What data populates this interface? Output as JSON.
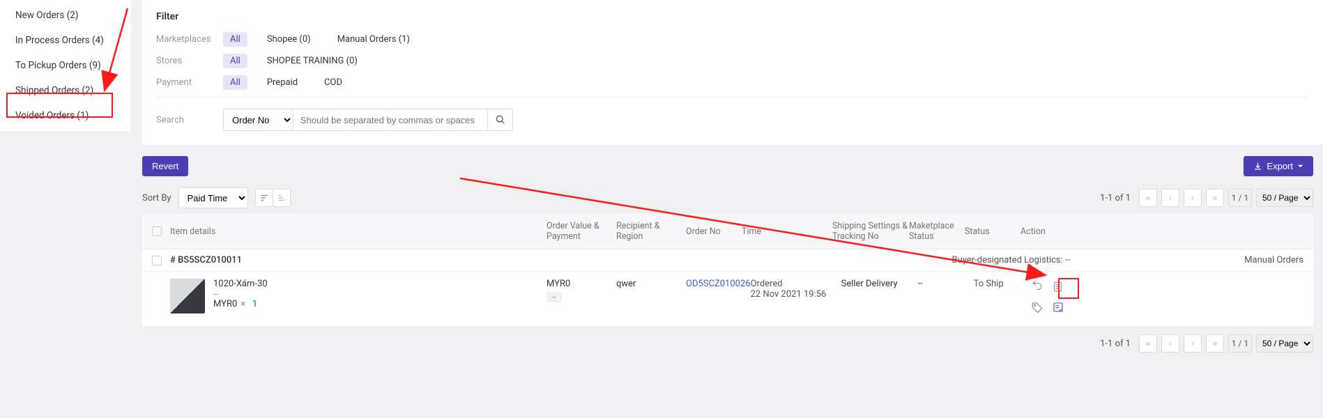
{
  "sidebar": {
    "items": [
      {
        "label": "New Orders (2)"
      },
      {
        "label": "In Process Orders (4)"
      },
      {
        "label": "To Pickup Orders (9)"
      },
      {
        "label": "Shipped Orders (2)"
      },
      {
        "label": "Voided Orders (1)"
      }
    ]
  },
  "filter": {
    "title": "Filter",
    "labels": {
      "marketplaces": "Marketplaces",
      "stores": "Stores",
      "payment": "Payment",
      "search": "Search"
    },
    "all_label": "All",
    "marketplaces": [
      {
        "label": "Shopee (0)"
      },
      {
        "label": "Manual Orders (1)"
      }
    ],
    "stores": [
      {
        "label": "SHOPEE TRAINING (0)"
      }
    ],
    "payment": [
      {
        "label": "Prepaid"
      },
      {
        "label": "COD"
      }
    ],
    "search_field": "Order No",
    "search_placeholder": "Should be separated by commas or spaces"
  },
  "actions": {
    "revert": "Revert",
    "export": "Export"
  },
  "sort": {
    "label": "Sort By",
    "value": "Paid Time"
  },
  "pagination": {
    "info": "1-1 of 1",
    "current": "1 / 1",
    "per_page": "50 / Page"
  },
  "table": {
    "headers": {
      "item": "Item details",
      "order_value": "Order Value & Payment",
      "recipient": "Recipient & Region",
      "order_no": "Order No",
      "time": "Time",
      "shipping": "Shipping Settings & Tracking No",
      "mk_status": "Maketplace Status",
      "status": "Status",
      "action": "Action"
    },
    "subheader": {
      "order_id": "# BS5SCZ010011",
      "logistics": "Buyer-designated Logistics: --",
      "source": "Manual Orders"
    },
    "row": {
      "product_name": "1020-Xám-30",
      "product_dash": "--",
      "price": "MYR0",
      "qty_x": "×",
      "qty": "1",
      "order_value": "MYR0",
      "order_value_dash": "--",
      "recipient": "qwer",
      "order_no": "OD5SCZ010026",
      "time_label": "Ordered",
      "time_value": "22 Nov 2021 19:56",
      "shipping": "Seller Delivery",
      "mk_status": "--",
      "status": "To Ship"
    }
  }
}
